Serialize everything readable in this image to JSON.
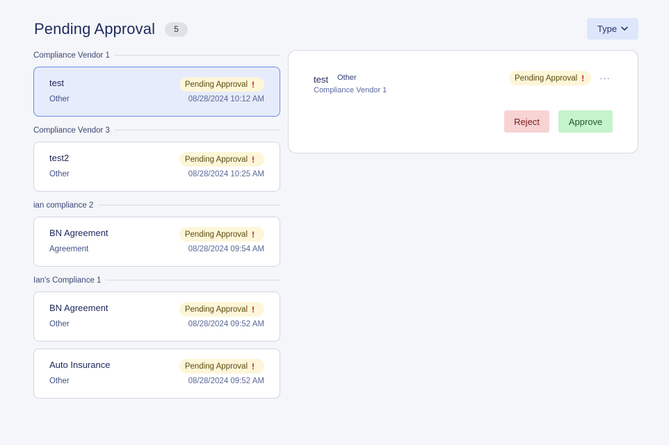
{
  "header": {
    "title": "Pending Approval",
    "count": "5",
    "type_button_label": "Type",
    "type_button_icon": "chevron-down-icon"
  },
  "groups": [
    {
      "name": "Compliance Vendor 1",
      "items": [
        {
          "title": "test",
          "subtitle": "Other",
          "status": "Pending Approval",
          "status_icon": "!",
          "date": "08/28/2024 10:12 AM",
          "selected": true
        }
      ]
    },
    {
      "name": "Compliance Vendor 3",
      "items": [
        {
          "title": "test2",
          "subtitle": "Other",
          "status": "Pending Approval",
          "status_icon": "!",
          "date": "08/28/2024 10:25 AM"
        }
      ]
    },
    {
      "name": "ian compliance 2",
      "items": [
        {
          "title": "BN Agreement",
          "subtitle": "Agreement",
          "status": "Pending Approval",
          "status_icon": "!",
          "date": "08/28/2024 09:54 AM"
        }
      ]
    },
    {
      "name": "Ian's Compliance 1",
      "items": [
        {
          "title": "BN Agreement",
          "subtitle": "Other",
          "status": "Pending Approval",
          "status_icon": "!",
          "date": "08/28/2024 09:52 AM"
        },
        {
          "title": "Auto Insurance",
          "subtitle": "Other",
          "status": "Pending Approval",
          "status_icon": "!",
          "date": "08/28/2024 09:52 AM"
        }
      ]
    }
  ],
  "detail": {
    "title": "test",
    "type": "Other",
    "vendor": "Compliance Vendor 1",
    "status": "Pending Approval",
    "status_icon": "!",
    "more_label": "···",
    "reject_label": "Reject",
    "approve_label": "Approve"
  },
  "colors": {
    "background": "#f5f6f9",
    "selected_card": "#e7ecfc",
    "selected_border": "#6a88e2",
    "status_pill": "#fdf6d8",
    "status_alert": "#c41d1d",
    "reject": "#f8d3d3",
    "approve": "#c5f3cc",
    "type_button": "#dde6fb"
  }
}
